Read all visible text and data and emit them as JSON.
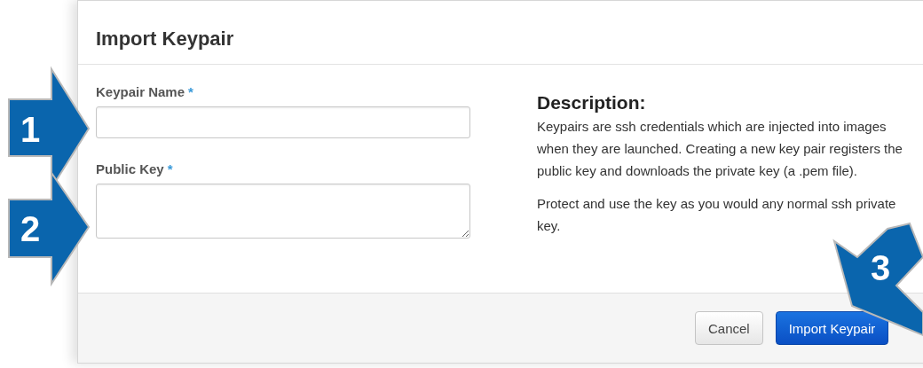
{
  "dialog": {
    "title": "Import Keypair"
  },
  "fields": [
    {
      "label": "Keypair Name",
      "required_mark": "*",
      "kind": "input"
    },
    {
      "label": "Public Key",
      "required_mark": "*",
      "kind": "textarea"
    }
  ],
  "description": {
    "heading": "Description:",
    "paragraphs": [
      "Keypairs are ssh credentials which are injected into images when they are launched. Creating a new key pair registers the public key and downloads the private key (a .pem file).",
      "Protect and use the key as you would any normal ssh private key."
    ]
  },
  "buttons": [
    {
      "label": "Cancel",
      "kind": "secondary"
    },
    {
      "label": "Import Keypair",
      "kind": "primary"
    }
  ],
  "callouts": [
    {
      "number": "1"
    },
    {
      "number": "2"
    },
    {
      "number": "3"
    }
  ]
}
